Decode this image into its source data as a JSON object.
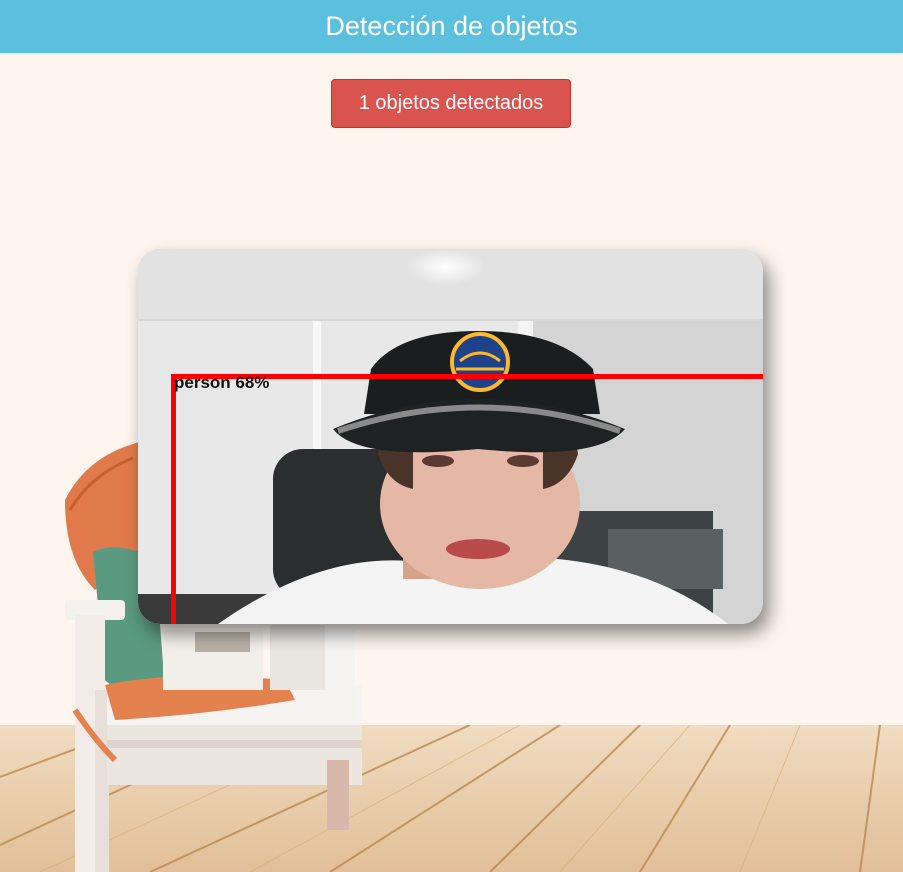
{
  "header": {
    "title": "Detección de objetos"
  },
  "status": {
    "count_label": "1 objetos detectados"
  },
  "detections": [
    {
      "label": "person 68%"
    }
  ],
  "colors": {
    "header_bg": "#5bc0de",
    "button_bg": "#d9534f",
    "detection_box": "#ff0000",
    "page_bg": "#fdf5ee"
  }
}
